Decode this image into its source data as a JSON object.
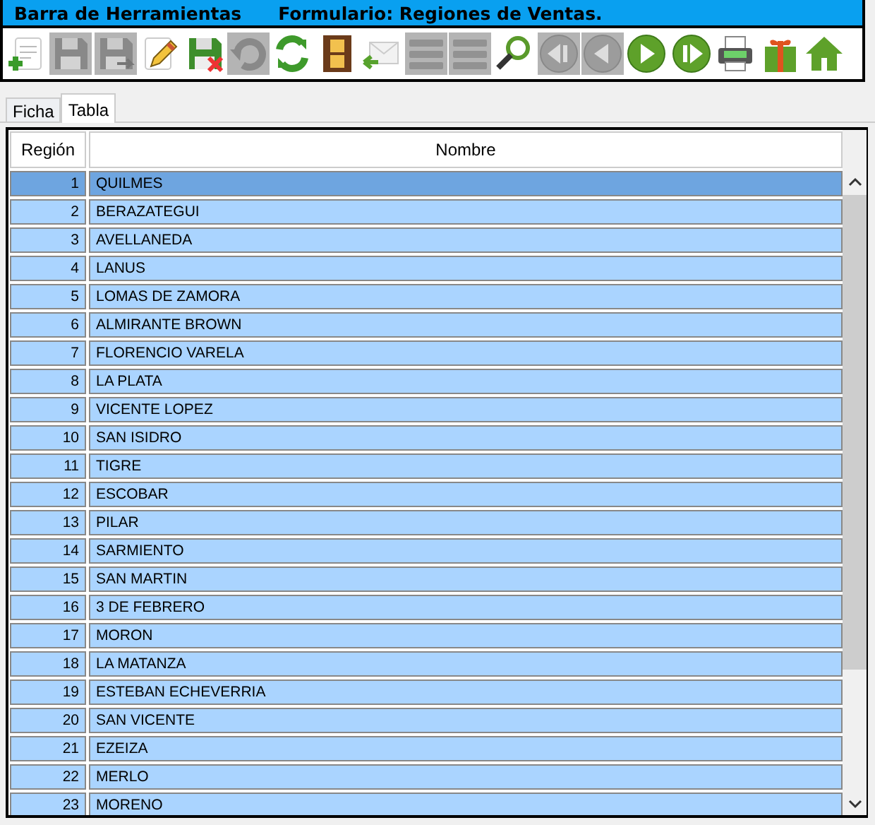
{
  "window": {
    "title": "Barra de Herramientas",
    "form_title": "Formulario: Regiones de Ventas."
  },
  "toolbar": [
    {
      "kind": "new",
      "disabled": false
    },
    {
      "kind": "save",
      "disabled": true
    },
    {
      "kind": "save-as",
      "disabled": true
    },
    {
      "kind": "edit",
      "disabled": false
    },
    {
      "kind": "save-cancel",
      "disabled": false
    },
    {
      "kind": "undo",
      "disabled": true
    },
    {
      "kind": "refresh",
      "disabled": false
    },
    {
      "kind": "film",
      "disabled": false
    },
    {
      "kind": "mail",
      "disabled": false
    },
    {
      "kind": "list-add",
      "disabled": true
    },
    {
      "kind": "list",
      "disabled": true
    },
    {
      "kind": "search",
      "disabled": false
    },
    {
      "kind": "first",
      "disabled": true
    },
    {
      "kind": "prev",
      "disabled": true
    },
    {
      "kind": "next",
      "disabled": false
    },
    {
      "kind": "last",
      "disabled": false
    },
    {
      "kind": "printer",
      "disabled": false
    },
    {
      "kind": "gift",
      "disabled": false
    },
    {
      "kind": "home",
      "disabled": false
    }
  ],
  "tabs": [
    {
      "label": "Ficha",
      "selected": false
    },
    {
      "label": "Tabla",
      "selected": true
    }
  ],
  "table": {
    "columns": [
      "Región",
      "Nombre"
    ],
    "rows": [
      {
        "region": "1",
        "nombre": "QUILMES",
        "selected": true
      },
      {
        "region": "2",
        "nombre": "BERAZATEGUI",
        "selected": false
      },
      {
        "region": "3",
        "nombre": "AVELLANEDA",
        "selected": false
      },
      {
        "region": "4",
        "nombre": "LANUS",
        "selected": false
      },
      {
        "region": "5",
        "nombre": "LOMAS DE ZAMORA",
        "selected": false
      },
      {
        "region": "6",
        "nombre": "ALMIRANTE BROWN",
        "selected": false
      },
      {
        "region": "7",
        "nombre": "FLORENCIO VARELA",
        "selected": false
      },
      {
        "region": "8",
        "nombre": "LA PLATA",
        "selected": false
      },
      {
        "region": "9",
        "nombre": "VICENTE LOPEZ",
        "selected": false
      },
      {
        "region": "10",
        "nombre": "SAN ISIDRO",
        "selected": false
      },
      {
        "region": "11",
        "nombre": "TIGRE",
        "selected": false
      },
      {
        "region": "12",
        "nombre": "ESCOBAR",
        "selected": false
      },
      {
        "region": "13",
        "nombre": "PILAR",
        "selected": false
      },
      {
        "region": "14",
        "nombre": "SARMIENTO",
        "selected": false
      },
      {
        "region": "15",
        "nombre": "SAN MARTIN",
        "selected": false
      },
      {
        "region": "16",
        "nombre": "3 DE FEBRERO",
        "selected": false
      },
      {
        "region": "17",
        "nombre": "MORON",
        "selected": false
      },
      {
        "region": "18",
        "nombre": "LA MATANZA",
        "selected": false
      },
      {
        "region": "19",
        "nombre": "ESTEBAN ECHEVERRIA",
        "selected": false
      },
      {
        "region": "20",
        "nombre": "SAN VICENTE",
        "selected": false
      },
      {
        "region": "21",
        "nombre": "EZEIZA",
        "selected": false
      },
      {
        "region": "22",
        "nombre": "MERLO",
        "selected": false
      },
      {
        "region": "23",
        "nombre": "MORENO",
        "selected": false
      }
    ]
  }
}
